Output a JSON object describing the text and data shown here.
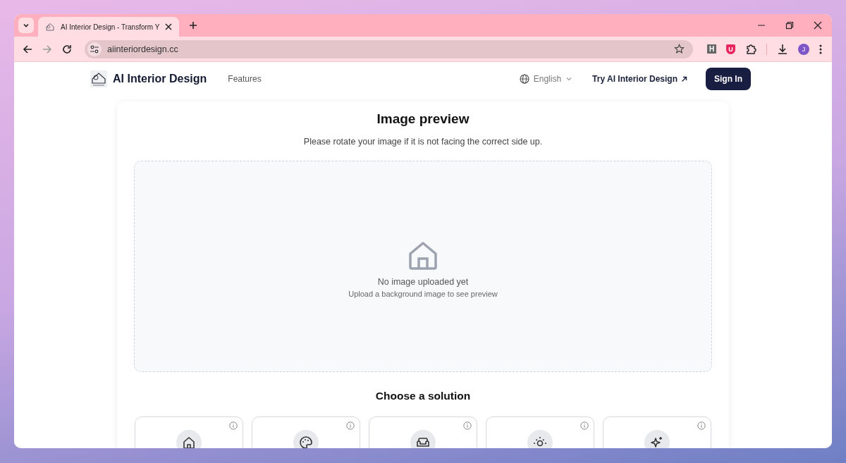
{
  "browser": {
    "tab_title": "AI Interior Design - Transform Y",
    "url": "aiinteriordesign.cc",
    "extension_letter": "H",
    "extension_shield": "U",
    "profile_initial": "J"
  },
  "nav": {
    "brand": "AI Interior Design",
    "links": [
      "Features"
    ],
    "language": "English",
    "try_link": "Try AI Interior Design",
    "sign_in": "Sign In"
  },
  "preview": {
    "title": "Image preview",
    "subtitle": "Please rotate your image if it is not facing the correct side up.",
    "empty_title": "No image uploaded yet",
    "empty_hint": "Upload a background image to see preview"
  },
  "solutions": {
    "title": "Choose a solution",
    "cards": [
      {
        "kind": "home"
      },
      {
        "kind": "palette"
      },
      {
        "kind": "sofa"
      },
      {
        "kind": "sun"
      },
      {
        "kind": "sparkle"
      }
    ]
  }
}
